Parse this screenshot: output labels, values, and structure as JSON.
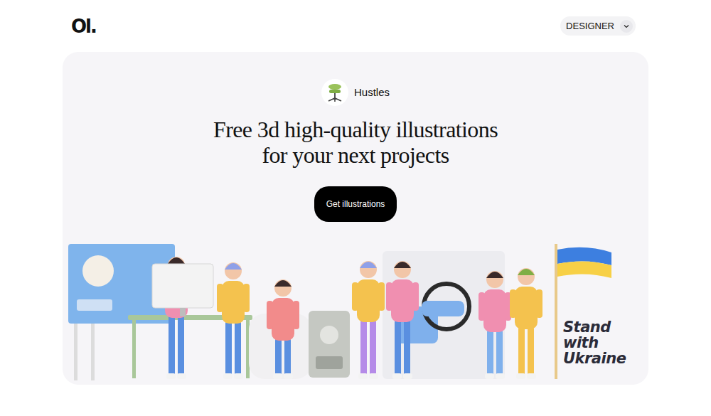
{
  "header": {
    "logo": "Ol.",
    "role_select": {
      "label": "DESIGNER"
    }
  },
  "hero": {
    "brand": "Hustles",
    "title": "Free 3d high-quality illustrations for your next projects",
    "button": "Get illustrations",
    "banner": "Stand with Ukraine"
  }
}
